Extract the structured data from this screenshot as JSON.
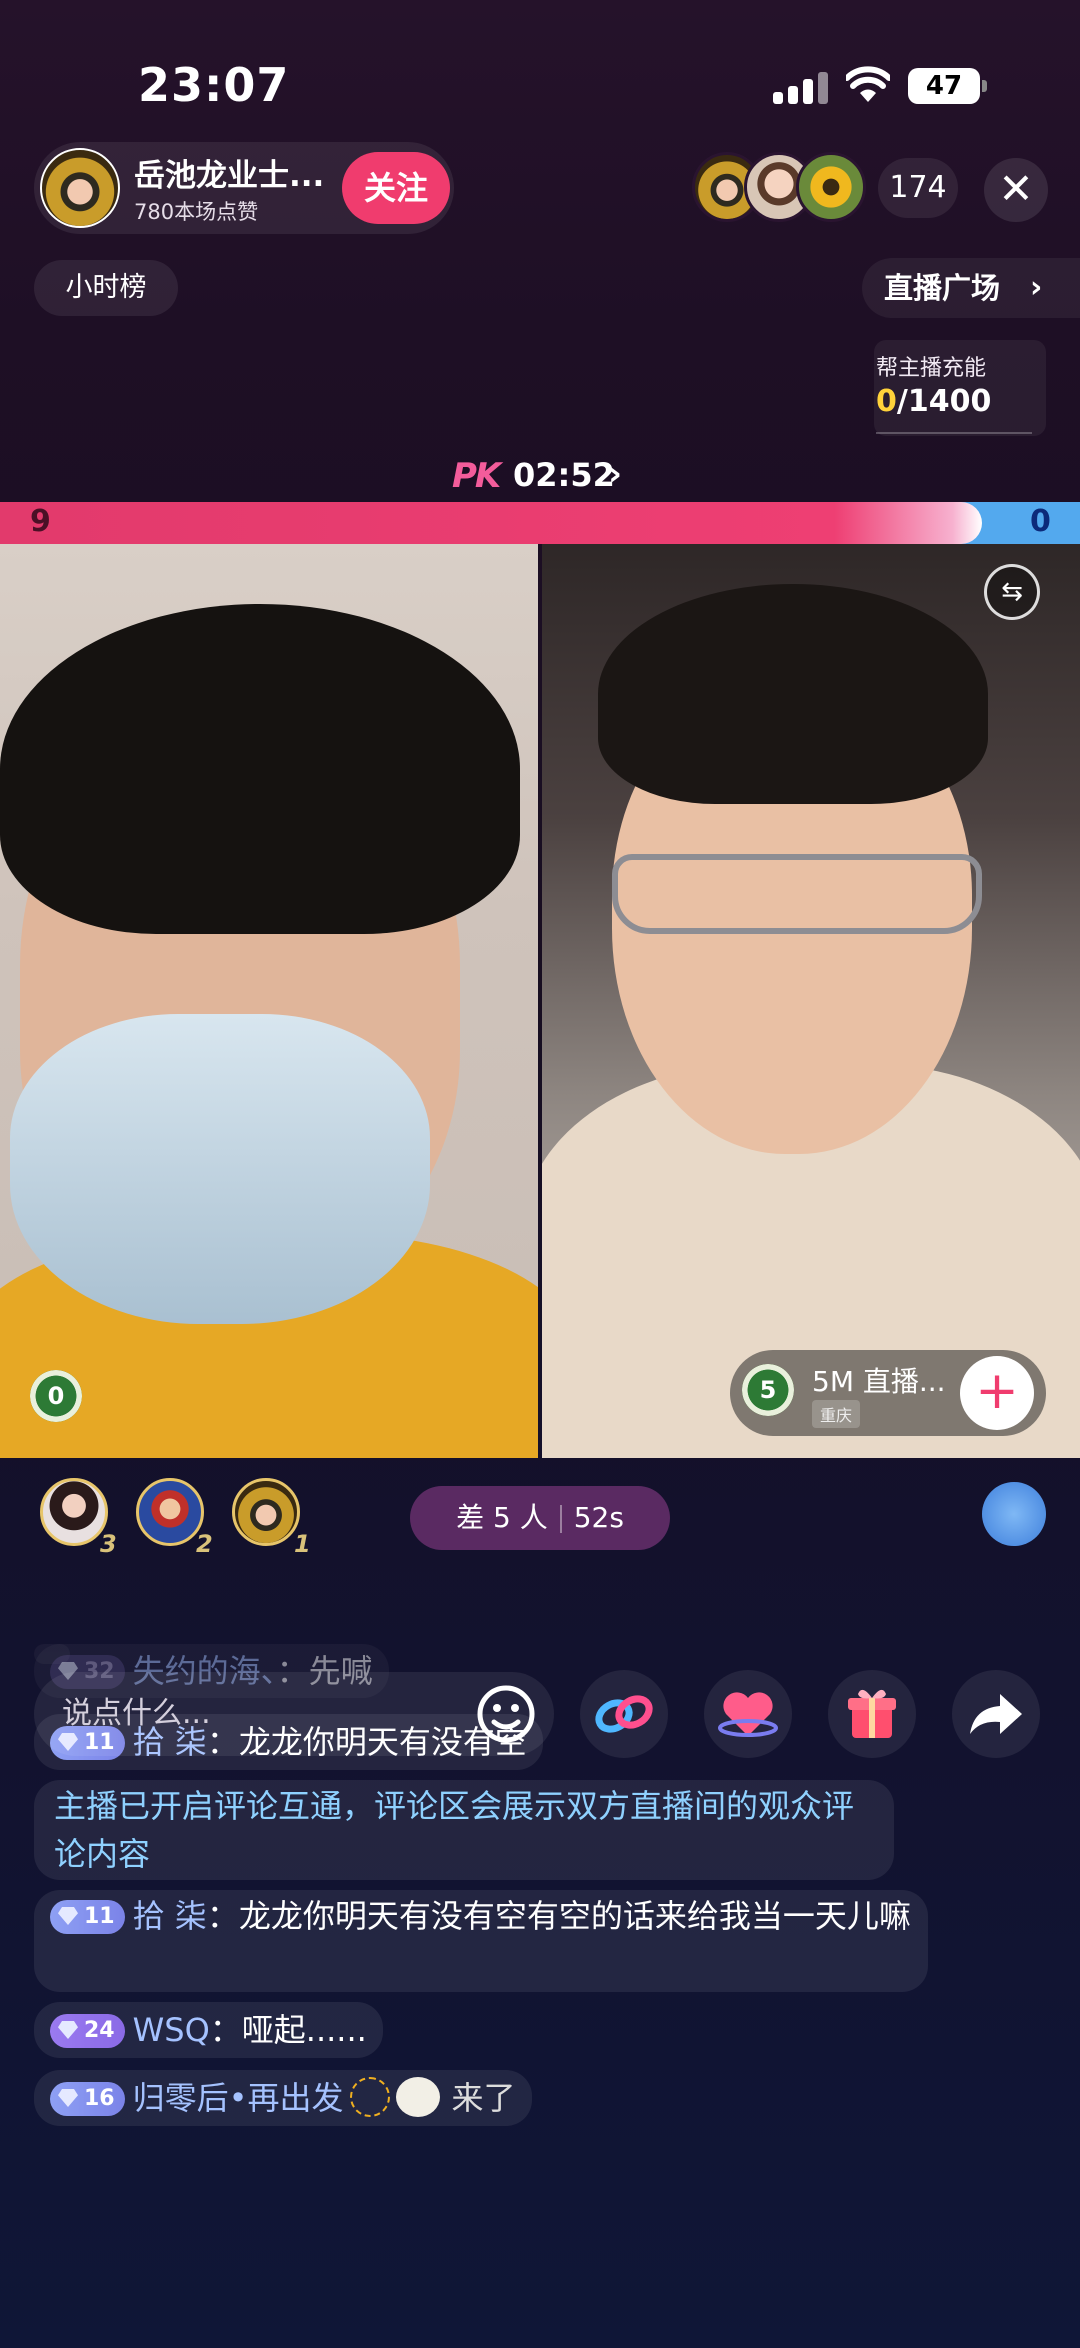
{
  "status": {
    "time": "23:07",
    "battery": "47"
  },
  "host": {
    "name": "岳池龙业士...",
    "likes": "780本场点赞",
    "follow_label": "关注"
  },
  "viewers": {
    "count": "174"
  },
  "nav": {
    "hour_rank": "小时榜",
    "plaza": "直播广场"
  },
  "charge": {
    "label": "帮主播充能",
    "current": "0",
    "sep": "/",
    "target": "1400"
  },
  "pk": {
    "logo": "PK",
    "timer": "02:52",
    "left_score": "9",
    "right_score": "0",
    "left_fraction": 0.909
  },
  "guest": {
    "level": "5",
    "name": "5M 直播...",
    "location": "重庆"
  },
  "host_level": "0",
  "fans": [
    {
      "rank": "3"
    },
    {
      "rank": "2"
    },
    {
      "rank": "1"
    }
  ],
  "diff": {
    "left": "差 5 人",
    "right": "52s"
  },
  "chat": [
    {
      "level": "32",
      "user": "失约的海、",
      "text": "先喊"
    },
    {
      "level": "11",
      "user": "拾 柒",
      "text": "龙龙你明天有没有空"
    },
    {
      "notice": "主播已开启评论互通，评论区会展示双方直播间的观众评论内容"
    },
    {
      "level": "11",
      "user": "拾 柒",
      "text": "龙龙你明天有没有空有空的话来给我当一天儿嘛"
    },
    {
      "level": "24",
      "user": "WSQ",
      "text": "哑起......"
    },
    {
      "level": "16",
      "user": "归零后•再出发",
      "text": "来了"
    }
  ],
  "input": {
    "placeholder": "说点什么..."
  },
  "colors": {
    "pk_red": "#ee3f73",
    "pk_blue": "#53a9ee",
    "follow": "#f03c6e",
    "charge_current": "#ffd23a"
  }
}
